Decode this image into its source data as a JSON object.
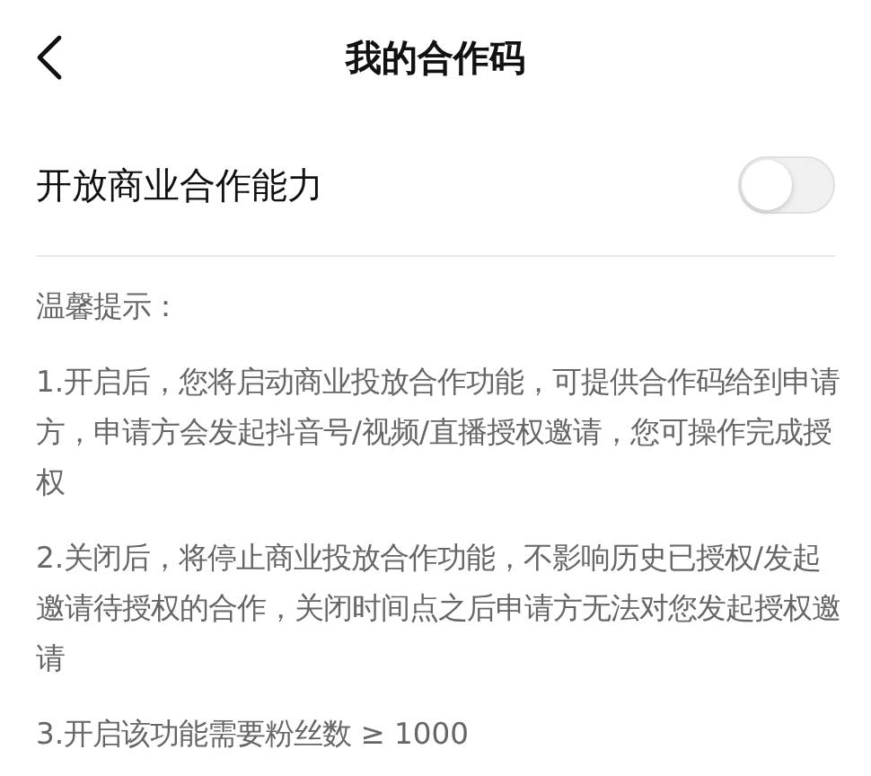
{
  "header": {
    "title": "我的合作码"
  },
  "setting": {
    "label": "开放商业合作能力",
    "on": false
  },
  "tips": {
    "heading": "温馨提示：",
    "paragraphs": [
      "1.开启后，您将启动商业投放合作功能，可提供合作码给到申请方，申请方会发起抖音号/视频/直播授权邀请，您可操作完成授权",
      "2.关闭后，将停止商业投放合作功能，不影响历史已授权/发起邀请待授权的合作，关闭时间点之后申请方无法对您发起授权邀请",
      "3.开启该功能需要粉丝数 ≥ 1000"
    ]
  }
}
